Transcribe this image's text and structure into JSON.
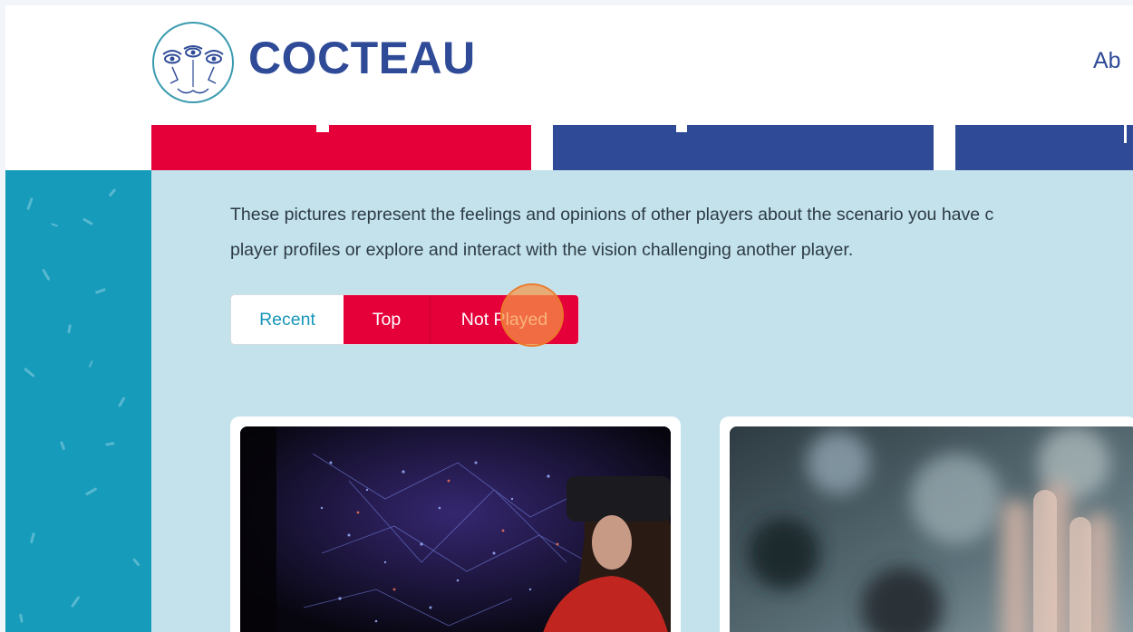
{
  "header": {
    "brand": "COCTEAU",
    "nav": {
      "about": "Ab"
    }
  },
  "content": {
    "description_line1": "These pictures represent the feelings and opinions of other players about the scenario you have c",
    "description_line2": "player profiles or explore and interact with the vision challenging another player.",
    "filters": [
      {
        "label": "Recent",
        "active": false
      },
      {
        "label": "Top",
        "active": true
      },
      {
        "label": "Not Played",
        "active": true
      }
    ]
  },
  "cards": [
    {
      "image": "vr-headset-particles"
    },
    {
      "image": "blurred-hand"
    }
  ],
  "colors": {
    "brand_blue": "#2f4b98",
    "accent_red": "#e5003a",
    "teal": "#169bbb",
    "light_blue": "#c3e2ec"
  }
}
